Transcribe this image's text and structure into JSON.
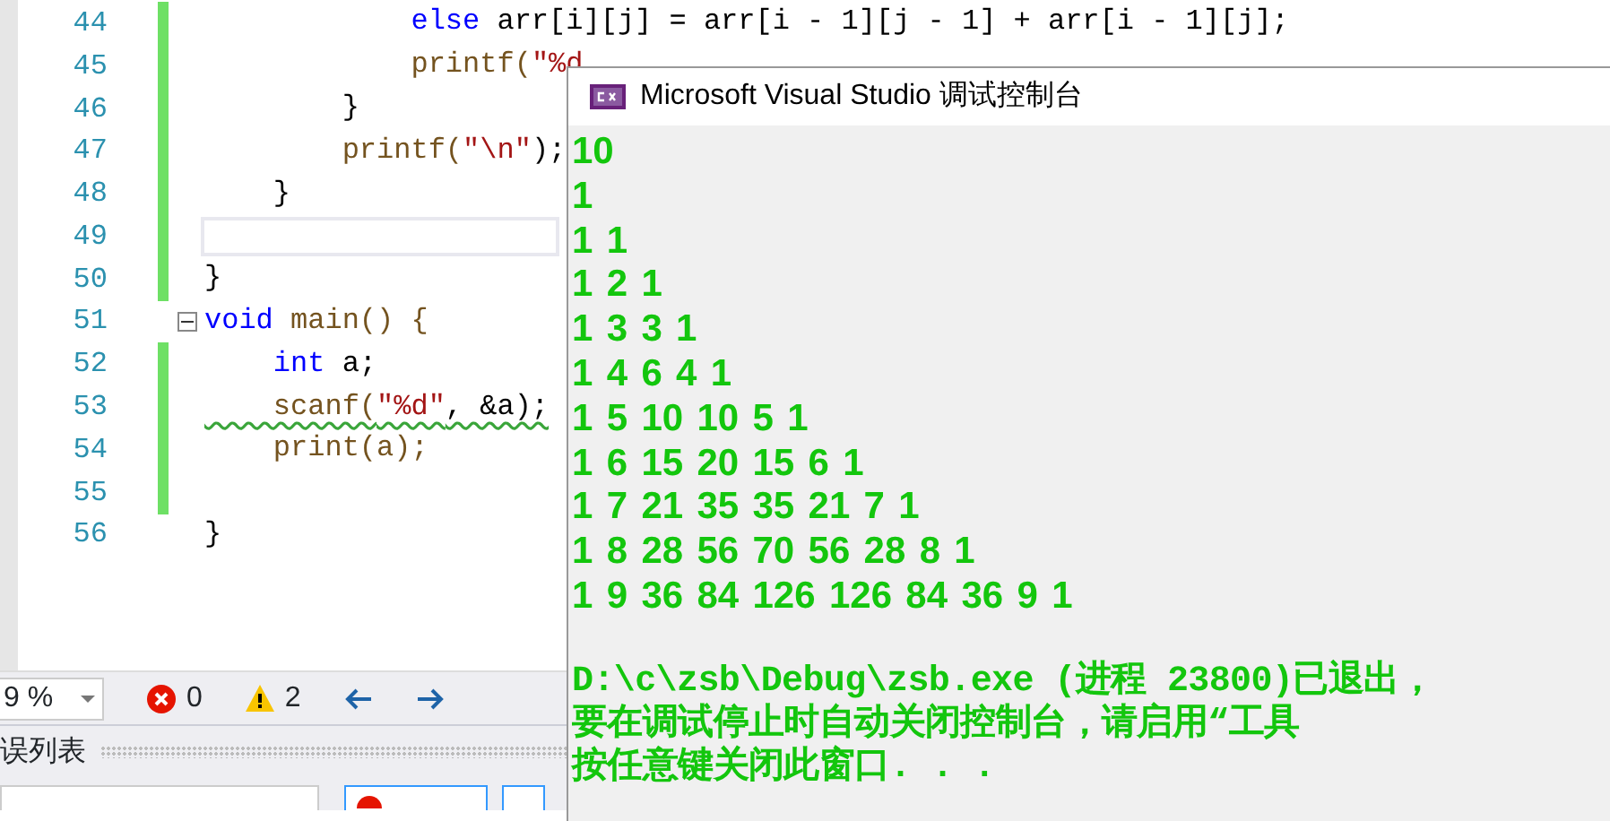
{
  "editor": {
    "lines": [
      {
        "number": "44",
        "changed": true,
        "current": false,
        "collapse": false,
        "tokens": [
          {
            "text": "            else",
            "kind": "keyword"
          },
          {
            "text": " arr[i][j] = arr[i - 1][j - 1] + arr[i - 1][j];",
            "kind": "plain"
          }
        ]
      },
      {
        "number": "45",
        "changed": true,
        "current": false,
        "collapse": false,
        "tokens": [
          {
            "text": "            printf(",
            "kind": "func"
          },
          {
            "text": "\"%d",
            "kind": "string"
          }
        ]
      },
      {
        "number": "46",
        "changed": true,
        "current": false,
        "collapse": false,
        "tokens": [
          {
            "text": "        }",
            "kind": "plain"
          }
        ]
      },
      {
        "number": "47",
        "changed": true,
        "current": false,
        "collapse": false,
        "tokens": [
          {
            "text": "        printf(",
            "kind": "func"
          },
          {
            "text": "\"\\n\"",
            "kind": "string"
          },
          {
            "text": ");",
            "kind": "plain"
          }
        ]
      },
      {
        "number": "48",
        "changed": true,
        "current": false,
        "collapse": false,
        "tokens": [
          {
            "text": "    }",
            "kind": "plain"
          }
        ]
      },
      {
        "number": "49",
        "changed": true,
        "current": true,
        "collapse": false
      },
      {
        "number": "50",
        "changed": true,
        "current": false,
        "collapse": false,
        "tokens": [
          {
            "text": "}",
            "kind": "plain"
          }
        ]
      },
      {
        "number": "51",
        "changed": false,
        "current": false,
        "collapse": true,
        "tokens": [
          {
            "text": "void",
            "kind": "keyword"
          },
          {
            "text": " main() {",
            "kind": "func"
          }
        ]
      },
      {
        "number": "52",
        "changed": true,
        "current": false,
        "collapse": false,
        "tokens": [
          {
            "text": "    int",
            "kind": "keyword"
          },
          {
            "text": " a;",
            "kind": "plain"
          }
        ]
      },
      {
        "number": "53",
        "changed": true,
        "current": false,
        "collapse": false,
        "tokens": [
          {
            "text": "    scanf(",
            "kind": "warnfunc"
          },
          {
            "text": "\"%d\"",
            "kind": "warnstring"
          },
          {
            "text": ", &a);",
            "kind": "warnplain"
          }
        ]
      },
      {
        "number": "54",
        "changed": true,
        "current": false,
        "collapse": false,
        "tokens": [
          {
            "text": "    print(a);",
            "kind": "func"
          }
        ]
      },
      {
        "number": "55",
        "changed": true,
        "current": false,
        "collapse": false
      },
      {
        "number": "56",
        "changed": false,
        "current": false,
        "collapse": false,
        "tokens": [
          {
            "text": "}",
            "kind": "plain"
          }
        ]
      }
    ]
  },
  "status_bar": {
    "zoom": "9 %",
    "errors": "0",
    "warnings": "2"
  },
  "error_list": {
    "title": "误列表"
  },
  "console": {
    "title": "Microsoft Visual Studio 调试控制台",
    "output": [
      {
        "text": "10",
        "kind": "number"
      },
      {
        "text": "1",
        "kind": "number"
      },
      {
        "text": "1  1",
        "kind": "number"
      },
      {
        "text": "1  2  1",
        "kind": "number"
      },
      {
        "text": "1  3  3  1",
        "kind": "number"
      },
      {
        "text": "1  4  6  4  1",
        "kind": "number"
      },
      {
        "text": "1  5  10  10  5  1",
        "kind": "number"
      },
      {
        "text": "1  6  15  20  15  6  1",
        "kind": "number"
      },
      {
        "text": "1  7  21  35  35  21  7  1",
        "kind": "number"
      },
      {
        "text": "1  8  28  56  70  56  28  8  1",
        "kind": "number"
      },
      {
        "text": "1  9  36  84  126  126  84  36  9  1",
        "kind": "number"
      },
      {
        "text": "D:\\c\\zsb\\Debug\\zsb.exe (进程 23800)已退出，",
        "kind": "message"
      },
      {
        "text": "要在调试停止时自动关闭控制台，请启用“工具",
        "kind": "message"
      },
      {
        "text": "按任意键关闭此窗口. . .",
        "kind": "message"
      }
    ]
  }
}
